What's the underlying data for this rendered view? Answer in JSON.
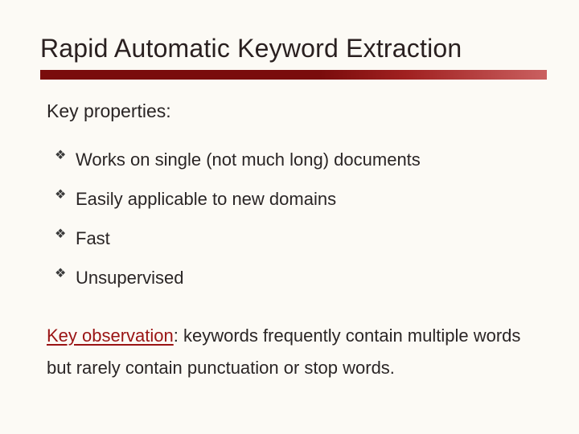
{
  "title": "Rapid Automatic Keyword Extraction",
  "section_head": "Key properties:",
  "bullets": [
    "Works on single (not much long) documents",
    "Easily applicable to new domains",
    "Fast",
    "Unsupervised"
  ],
  "observation": {
    "label": "Key observation",
    "text": ": keywords frequently contain multiple words but rarely contain punctuation or stop words."
  }
}
